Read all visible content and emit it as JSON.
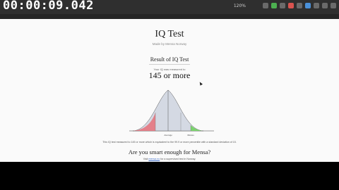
{
  "overlay": {
    "timer": "00:00:09.042"
  },
  "browser": {
    "zoom": "120%"
  },
  "page": {
    "title": "IQ Test",
    "subtitle": "Made by Mensa Norway",
    "result_title": "Result of IQ Test",
    "score_caption": "Your IQ was measured to",
    "score": "145 or more",
    "explanation": "This IQ test measured to 145 or more which is equivalent to the 99.9 or more percentile with a standard deviation of 15.",
    "mensa_question": "Are you smart enough for Mensa?",
    "mensa_prefix": "Visit",
    "mensa_link": "mensa.no",
    "mensa_suffix": "for a supervised test in Norway."
  },
  "chart": {
    "labels": {
      "avg": "Average",
      "mensa": "Mensa"
    },
    "colors": {
      "left_tail": "#e57580",
      "body": "#d4d9e3",
      "right_tail": "#7bd36d"
    }
  }
}
